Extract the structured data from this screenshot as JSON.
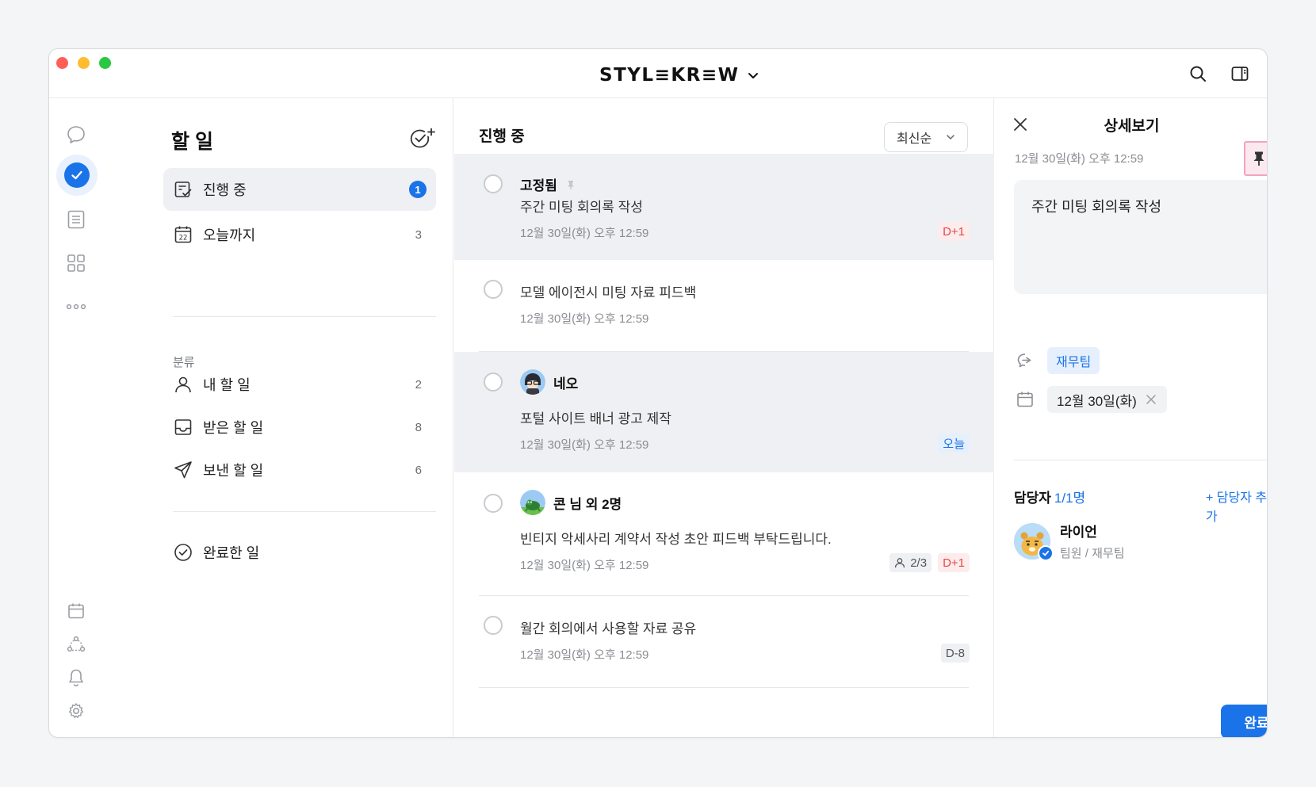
{
  "app": {
    "brand": "STYL≡KR≡W",
    "window_controls": [
      "close",
      "minimize",
      "zoom"
    ]
  },
  "rail": {
    "icons": [
      "chat-icon",
      "todo-check-icon",
      "memo-icon",
      "grid-icon",
      "more-icon",
      "calendar-icon",
      "org-chart-icon",
      "bell-icon",
      "gear-icon"
    ]
  },
  "left": {
    "title": "할 일",
    "items": [
      {
        "label": "진행 중",
        "badge": "1",
        "icon": "in-progress-icon"
      },
      {
        "label": "오늘까지",
        "count": "3",
        "icon": "calendar-22-icon"
      }
    ],
    "section_label": "분류",
    "categories": [
      {
        "label": "내 할 일",
        "count": "2",
        "icon": "person-icon"
      },
      {
        "label": "받은 할 일",
        "count": "8",
        "icon": "inbox-icon"
      },
      {
        "label": "보낸 할 일",
        "count": "6",
        "icon": "send-icon"
      }
    ],
    "completed_label": "완료한 일"
  },
  "middle": {
    "title": "진행 중",
    "sort_label": "최신순",
    "tasks": [
      {
        "who": "고정됨",
        "title": "주간 미팅 회의록 작성",
        "date": "12월 30일(화) 오후 12:59",
        "tag": "D+1"
      },
      {
        "title": "모델 에이전시 미팅 자료 피드백",
        "date": "12월 30일(화) 오후 12:59"
      },
      {
        "who": "네오",
        "title": "포털 사이트 배너 광고 제작",
        "date": "12월 30일(화) 오후 12:59",
        "tag": "오늘"
      },
      {
        "who": "콘 님 외 2명",
        "title": "빈티지 악세사리 계약서 작성 초안 피드백 부탁드립니다.",
        "date": "12월 30일(화) 오후 12:59",
        "people": "2/3",
        "tag": "D+1"
      },
      {
        "title": "월간 회의에서 사용할 자료 공유",
        "date": "12월 30일(화) 오후 12:59",
        "tag": "D-8"
      }
    ]
  },
  "detail": {
    "title": "상세보기",
    "date": "12월 30일(화) 오후 12:59",
    "note": "주간 미팅 회의록 작성",
    "room_chip": "재무팀",
    "due_chip": "12월 30일(화)",
    "assignee_label": "담당자",
    "assignee_count": "1/1명",
    "add_assignee": "+ 담당자 추가",
    "assignee": {
      "name": "라이언",
      "role": "팀원 / 재무팀"
    },
    "done_button": "완료"
  },
  "colors": {
    "accent": "#1a73e8",
    "danger": "#e5484d",
    "highlight": "#fce9f0"
  }
}
